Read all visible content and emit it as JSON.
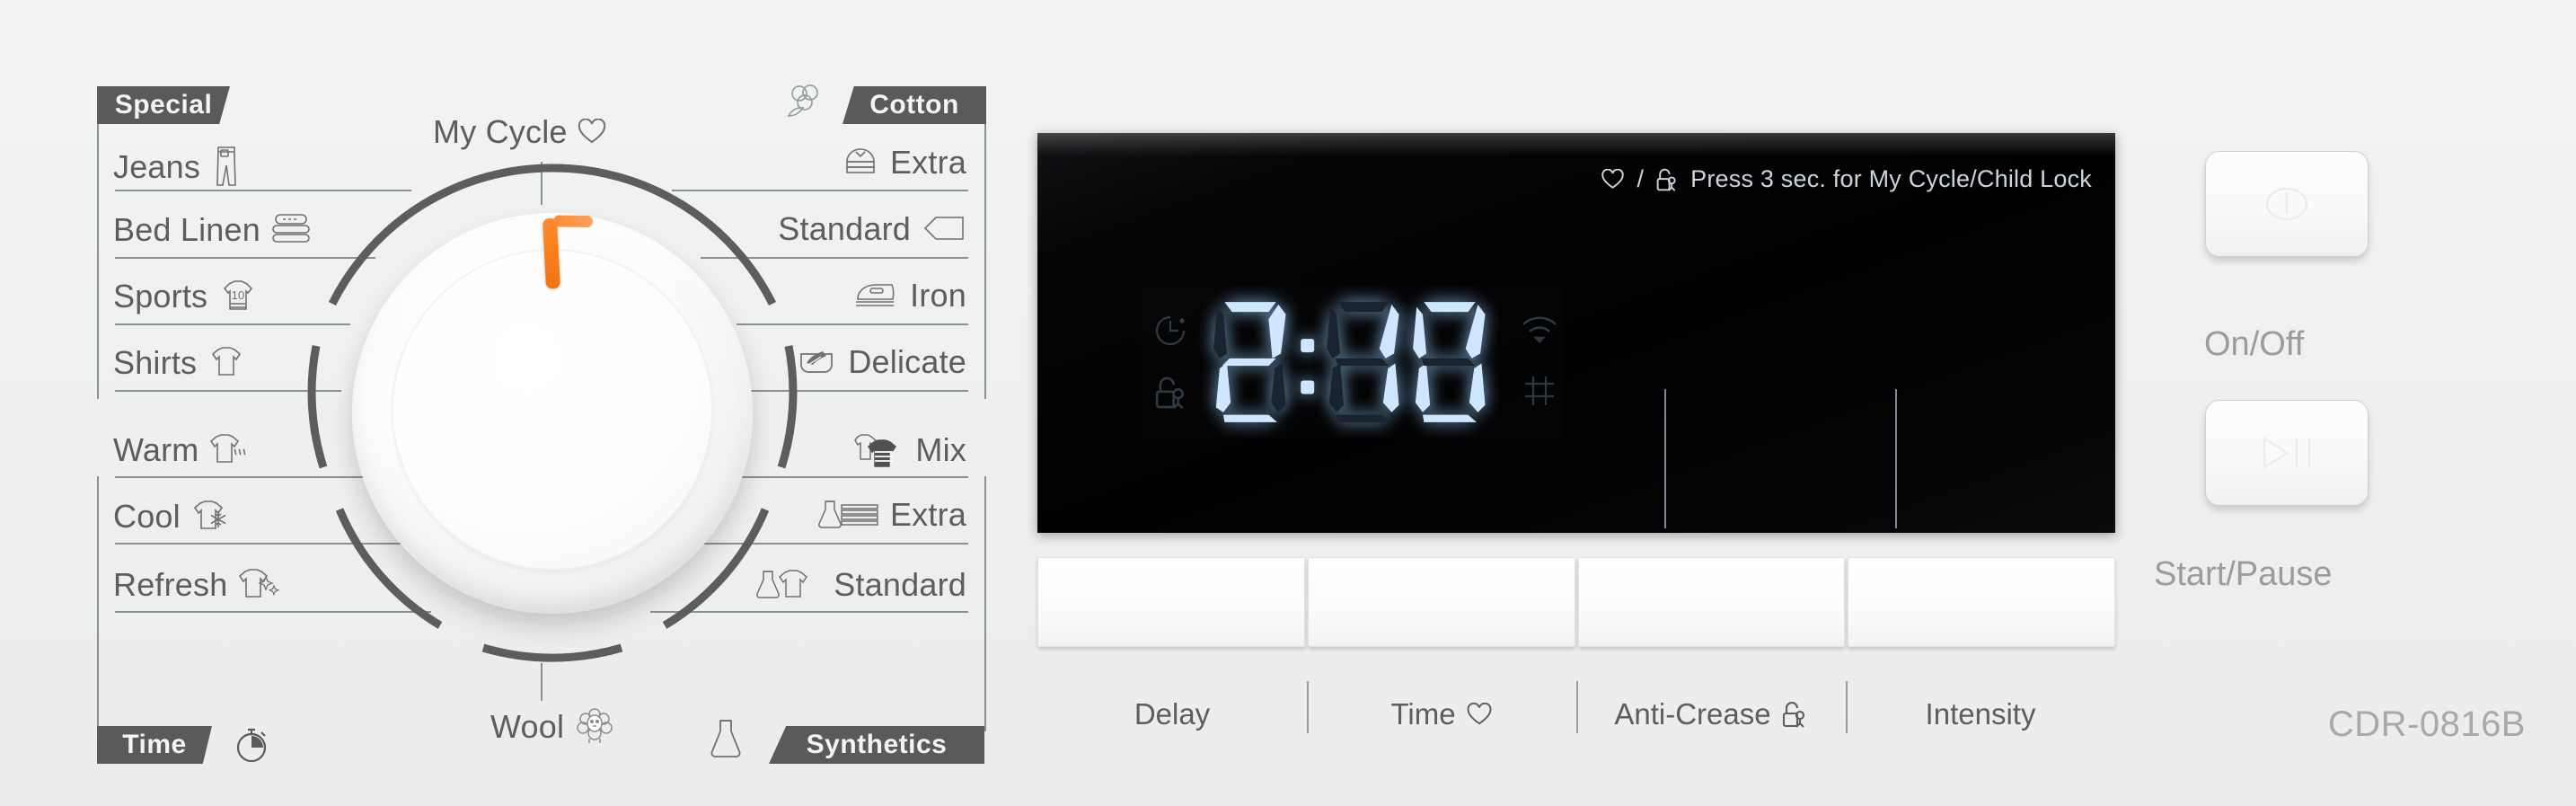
{
  "device": {
    "model": "CDR-0816B"
  },
  "dial": {
    "pointer_color": "#f97c1b",
    "selected_program": "My Cycle",
    "top_label": "My Cycle",
    "top_label_icon": "heart-icon",
    "bottom_label": "Wool",
    "bottom_label_icon": "sheep-icon",
    "groups": [
      {
        "name": "Special",
        "side": "left"
      },
      {
        "name": "Time",
        "side": "left",
        "icon": "stopwatch-icon"
      },
      {
        "name": "Cotton",
        "side": "right",
        "icon": "cotton-flower-icon"
      },
      {
        "name": "Synthetics",
        "side": "right",
        "icon": "flask-icon"
      }
    ],
    "left_programs": [
      {
        "label": "Jeans",
        "icon": "jeans-icon"
      },
      {
        "label": "Bed Linen",
        "icon": "folded-linen-icon"
      },
      {
        "label": "Sports",
        "icon": "sports-jersey-10-icon"
      },
      {
        "label": "Shirts",
        "icon": "tshirt-icon"
      },
      {
        "label": "Warm",
        "icon": "tshirt-warm-icon"
      },
      {
        "label": "Cool",
        "icon": "tshirt-snowflake-icon"
      },
      {
        "label": "Refresh",
        "icon": "tshirt-sparkle-icon"
      }
    ],
    "right_programs": [
      {
        "label": "Extra",
        "icon": "folded-shirt-icon"
      },
      {
        "label": "Standard",
        "icon": "pillow-icon"
      },
      {
        "label": "Iron",
        "icon": "iron-icon"
      },
      {
        "label": "Delicate",
        "icon": "handwash-icon"
      },
      {
        "label": "Mix",
        "icon": "two-shirts-icon"
      },
      {
        "label": "Extra",
        "icon": "flask-towels-icon"
      },
      {
        "label": "Standard",
        "icon": "flask-shirt-icon"
      }
    ]
  },
  "display": {
    "hint_text": "Press 3 sec. for My Cycle/Child Lock",
    "hint_icons": [
      "heart-icon",
      "child-lock-icon"
    ],
    "lcd_value": "2:10",
    "lcd_color": "#cfe6ff",
    "left_indicators": [
      {
        "name": "delay-timer-icon",
        "active": false
      },
      {
        "name": "child-lock-icon",
        "active": false
      }
    ],
    "right_indicators": [
      {
        "name": "wifi-icon",
        "active": false
      },
      {
        "name": "anti-crease-icon",
        "active": false
      }
    ]
  },
  "function_buttons": [
    {
      "label": "Delay",
      "icon": null
    },
    {
      "label": "Time",
      "icon": "heart-icon"
    },
    {
      "label": "Anti-Crease",
      "icon": "child-lock-icon"
    },
    {
      "label": "Intensity",
      "icon": null
    }
  ],
  "power_buttons": [
    {
      "label": "On/Off",
      "icon": "power-icon"
    },
    {
      "label": "Start/Pause",
      "icon": "play-pause-icon"
    }
  ]
}
